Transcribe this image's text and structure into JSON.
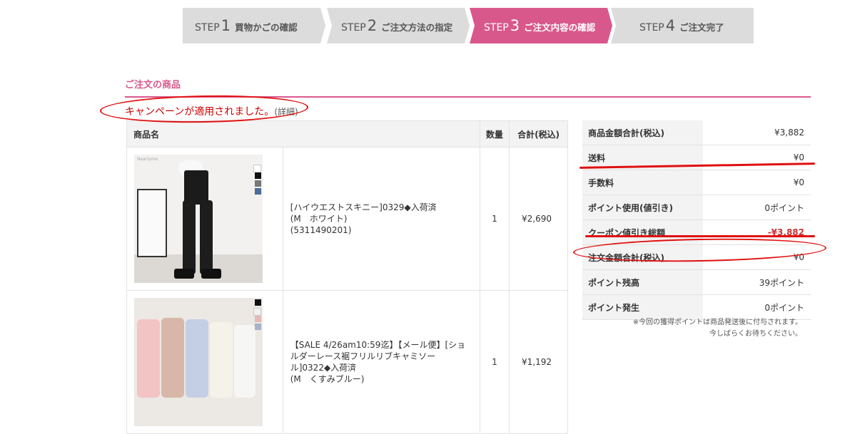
{
  "steps": [
    {
      "label": "STEP",
      "num": "1",
      "text": "買物かごの確認",
      "active": false
    },
    {
      "label": "STEP",
      "num": "2",
      "text": "ご注文方法の指定",
      "active": false
    },
    {
      "label": "STEP",
      "num": "3",
      "text": "ご注文内容の確認",
      "active": true
    },
    {
      "label": "STEP",
      "num": "4",
      "text": "ご注文完了",
      "active": false
    }
  ],
  "section_title": "ご注文の商品",
  "campaign": {
    "message": "キャンペーンが適用されました。",
    "detail": "(詳細)"
  },
  "items_table": {
    "headers": {
      "name": "商品名",
      "qty": "数量",
      "total": "合計(税込)"
    },
    "rows": [
      {
        "name": "[ハイウエストスキニー]0329◆入荷済",
        "variant": "(M　ホワイト)",
        "code": "(5311490201)",
        "qty": "1",
        "total": "¥2,690",
        "brand": "Nearlyme"
      },
      {
        "name": "【SALE 4/26am10:59迄】【メール便】[ショルダーレース裾フリルリブキャミソール]0322◆入荷済",
        "variant": "(M　くすみブルー)",
        "code": "",
        "qty": "1",
        "total": "¥1,192",
        "brand": ""
      }
    ]
  },
  "summary": [
    {
      "label": "商品金額合計(税込)",
      "value": "¥3,882",
      "negative": false
    },
    {
      "label": "送料",
      "value": "¥0",
      "negative": false
    },
    {
      "label": "手数料",
      "value": "¥0",
      "negative": false
    },
    {
      "label": "ポイント使用(値引き)",
      "value": "0ポイント",
      "negative": false
    },
    {
      "label": "クーポン値引き総額",
      "value": "-¥3,882",
      "negative": true
    },
    {
      "label": "注文金額合計(税込)",
      "value": "¥0",
      "negative": false
    },
    {
      "label": "ポイント残高",
      "value": "39ポイント",
      "negative": false
    },
    {
      "label": "ポイント発生",
      "value": "0ポイント",
      "negative": false
    }
  ],
  "note": {
    "line1": "※今回の獲得ポイントは商品発送後に付与されます。",
    "line2": "今しばらくお待ちください。"
  },
  "colors": {
    "accent": "#d9588c",
    "annotation": "#e01010",
    "negative": "#cc3333"
  }
}
